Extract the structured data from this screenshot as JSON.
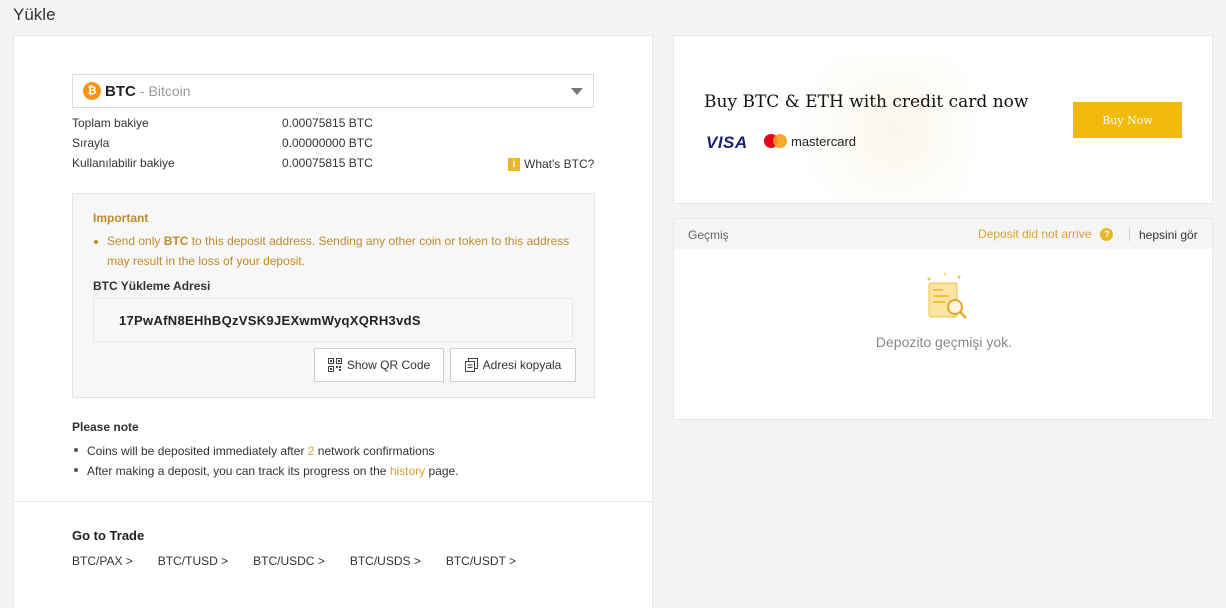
{
  "page": {
    "title": "Yükle"
  },
  "coin_select": {
    "icon_glyph": "₿",
    "symbol": "BTC",
    "separator": "-",
    "name": "Bitcoin"
  },
  "balances": [
    {
      "label": "Toplam bakiye",
      "value": "0.00075815 BTC"
    },
    {
      "label": "Sırayla",
      "value": "0.00000000 BTC"
    },
    {
      "label": "Kullanılabilir bakiye",
      "value": "0.00075815 BTC"
    }
  ],
  "whats_btc": {
    "icon_glyph": "i",
    "label": "What's BTC?"
  },
  "important": {
    "title": "Important",
    "text_before": "Send only ",
    "text_strong": "BTC",
    "text_after": " to this deposit address. Sending any other coin or token to this address may result in the loss of your deposit."
  },
  "deposit": {
    "address_label": "BTC Yükleme Adresi",
    "address": "17PwAfN8EHhBQzVSK9JEXwmWyqXQRH3vdS",
    "qr_button": "Show QR Code",
    "copy_button": "Adresi kopyala"
  },
  "note": {
    "title": "Please note",
    "line1_before": "Coins will be deposited immediately after ",
    "line1_num": "2",
    "line1_after": " network confirmations",
    "line2_before": "After making a deposit, you can track its progress on the ",
    "line2_link": "history",
    "line2_after": " page."
  },
  "trade": {
    "title": "Go to Trade",
    "links": [
      "BTC/PAX >",
      "BTC/TUSD >",
      "BTC/USDC >",
      "BTC/USDS >",
      "BTC/USDT >"
    ]
  },
  "promo": {
    "title": "Buy BTC & ETH with credit card now",
    "visa": "VISA",
    "mastercard": "mastercard",
    "button": "Buy Now"
  },
  "history": {
    "title": "Geçmiş",
    "deposit_link": "Deposit did not arrive",
    "help_glyph": "?",
    "see_all": "hepsini gör",
    "empty_text": "Depozito geçmişi yok."
  },
  "colors": {
    "accent": "#f0b90b",
    "link": "#d9a034",
    "important": "#c28a2a",
    "btc": "#f7931a"
  }
}
